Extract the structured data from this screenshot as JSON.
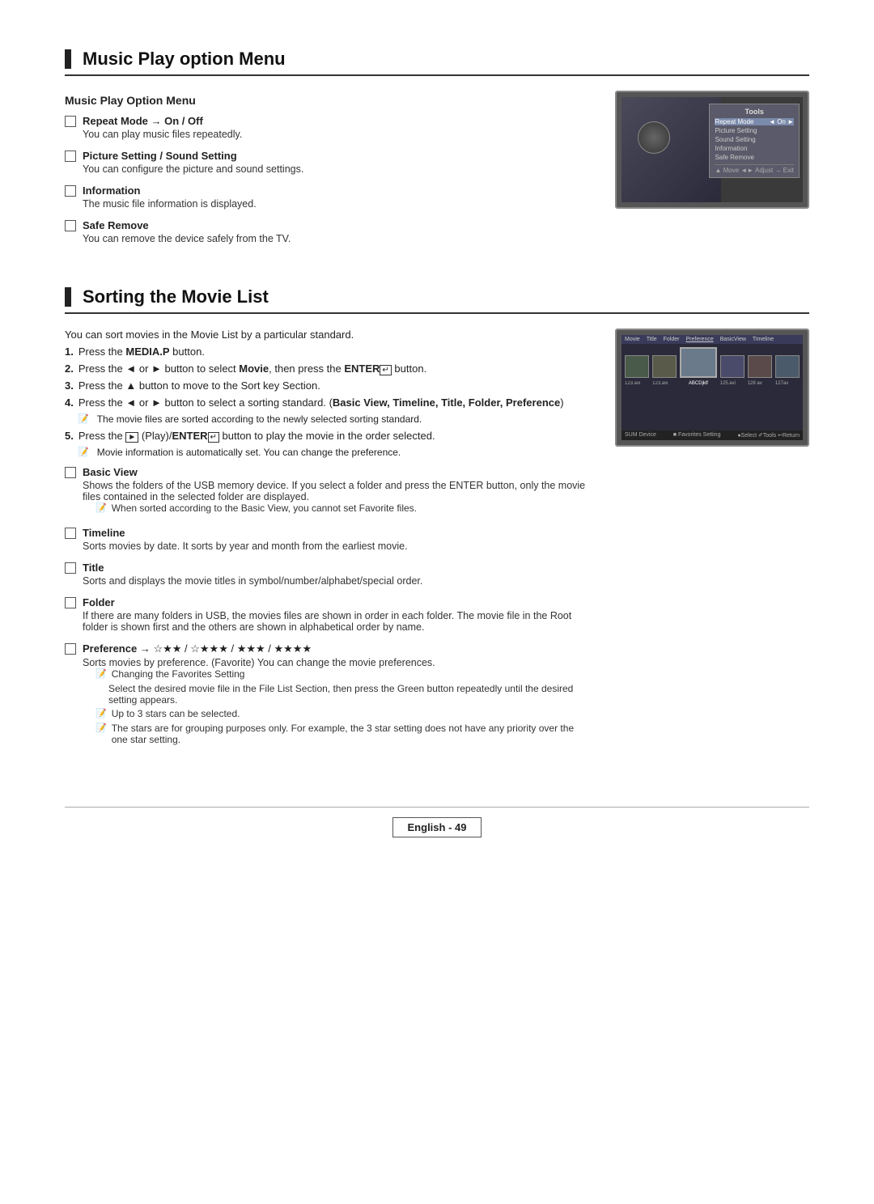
{
  "page": {
    "sections": [
      {
        "id": "music-play",
        "title": "Music Play option Menu",
        "subsection_title": "Music Play Option Menu",
        "items": [
          {
            "title": "Repeat Mode → On / Off",
            "desc": "You can play music files repeatedly."
          },
          {
            "title": "Picture Setting / Sound Setting",
            "desc": "You can configure the picture and sound settings."
          },
          {
            "title": "Information",
            "desc": "The music file information is displayed."
          },
          {
            "title": "Safe Remove",
            "desc": "You can remove the device safely from the TV."
          }
        ],
        "tools_panel": {
          "title": "Tools",
          "rows": [
            {
              "label": "Repeat Mode",
              "value": "On",
              "selected": true
            },
            {
              "label": "Picture Setting",
              "value": ""
            },
            {
              "label": "Sound Setting",
              "value": ""
            },
            {
              "label": "Information",
              "value": ""
            },
            {
              "label": "Safe Remove",
              "value": ""
            }
          ],
          "nav": "▲ Move  ◄► Adjust  → Exit"
        }
      },
      {
        "id": "sorting-movie",
        "title": "Sorting the Movie List",
        "intro": "You can sort movies in the Movie List by a particular standard.",
        "steps": [
          {
            "num": "1.",
            "text": "Press the MEDIA.P button."
          },
          {
            "num": "2.",
            "text": "Press the ◄ or ► button to select Movie, then press the ENTER button."
          },
          {
            "num": "3.",
            "text": "Press the ▲ button to move to the Sort key Section."
          },
          {
            "num": "4.",
            "text": "Press the ◄ or ► button to select a sorting standard. (Basic View, Timeline, Title, Folder, Preference)"
          },
          {
            "num": "4_note",
            "text": "The movie files are sorted according to the newly selected sorting standard."
          },
          {
            "num": "5.",
            "text": "Press the ► (Play)/ENTER button to play the movie in the order selected."
          },
          {
            "num": "5_note",
            "text": "Movie information is automatically set. You can change the preference."
          }
        ],
        "items": [
          {
            "title": "Basic View",
            "desc": "Shows the folders of the USB memory device. If you select a folder and press the ENTER button, only the movie files contained in the selected folder are displayed.",
            "note": "When sorted according to the Basic View, you cannot set Favorite files."
          },
          {
            "title": "Timeline",
            "desc": "Sorts movies by date. It sorts by year and month from the earliest movie.",
            "note": null
          },
          {
            "title": "Title",
            "desc": "Sorts and displays the movie titles in symbol/number/alphabet/special order.",
            "note": null
          },
          {
            "title": "Folder",
            "desc": "If there are many folders in USB, the movies files are shown in order in each folder. The movie file in the Root folder is shown first and the others are shown in alphabetical order by name.",
            "note": null
          },
          {
            "title": "Preference → ☆★★ / ☆★★★ / ★★★ / ★★★★",
            "desc": "Sorts movies by preference. (Favorite) You can change the movie preferences.",
            "notes": [
              "Changing the Favorites Setting",
              "Select the desired movie file in the File List Section, then press the Green button repeatedly until the desired setting appears.",
              "Up to 3 stars can be selected.",
              "The stars are for grouping purposes only. For example, the 3 star setting does not have any priority over the one star setting."
            ]
          }
        ],
        "movie_screen": {
          "tabs": [
            "Title",
            "Folder",
            "Preference",
            "BasicView",
            "Timeline"
          ],
          "nav": "SUM  Device  ■ Favorites Setting  ● Select  ✐ Tools  ↩ Return"
        }
      }
    ],
    "footer": {
      "label": "English - 49"
    }
  }
}
